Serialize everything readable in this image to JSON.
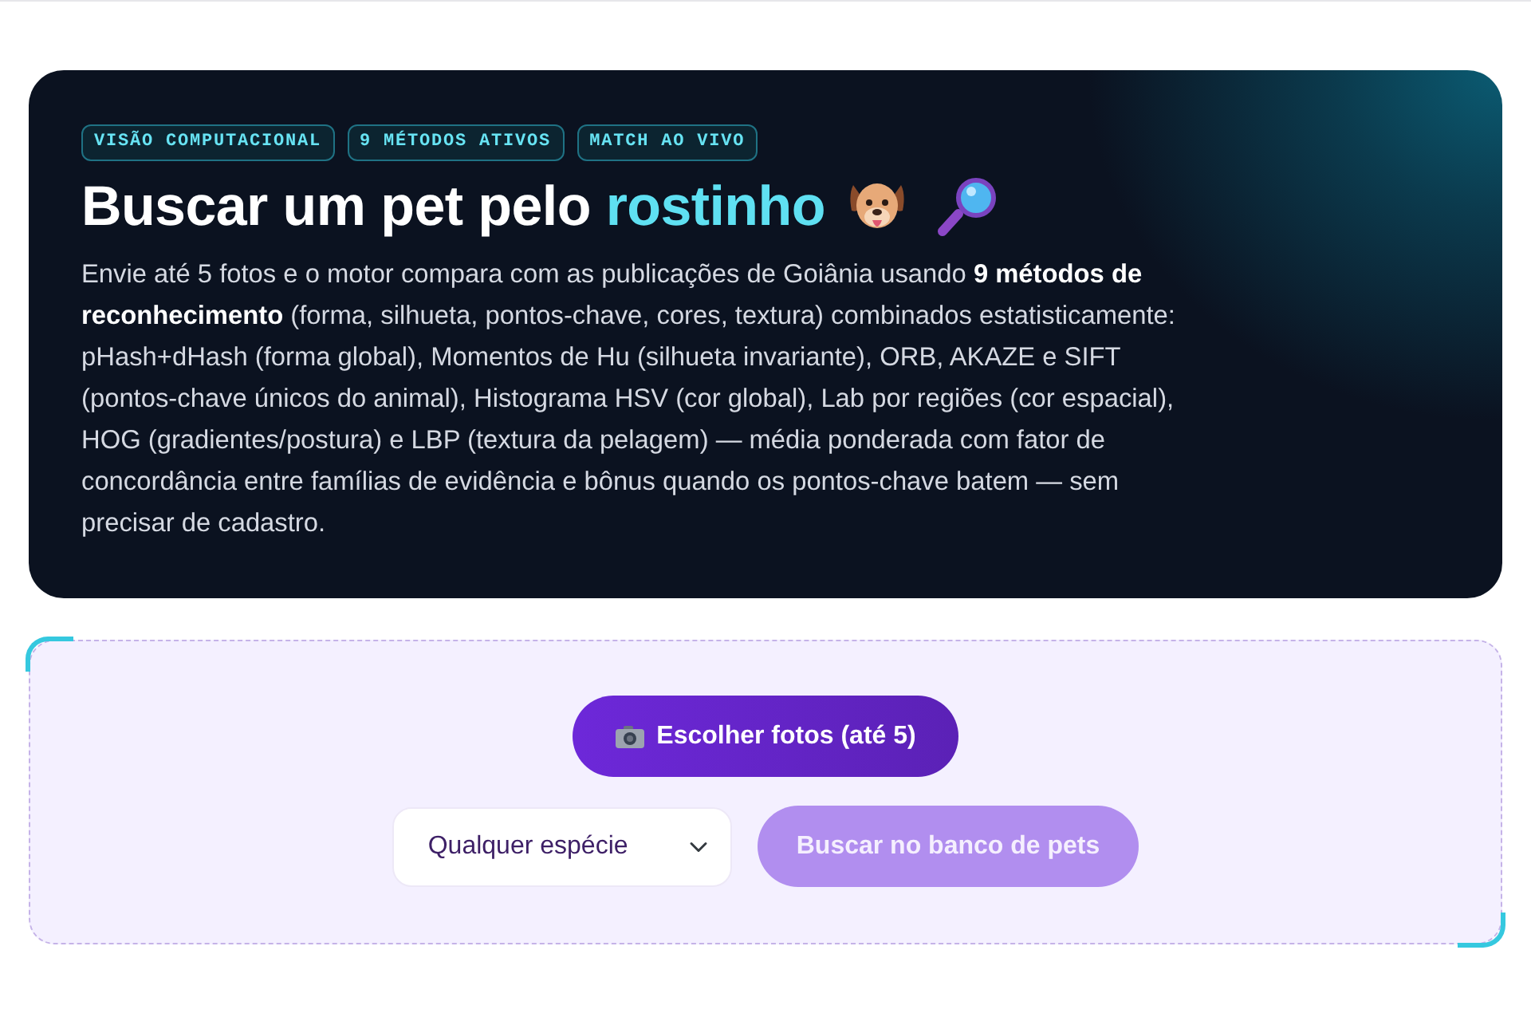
{
  "hero": {
    "badges": [
      "VISÃO COMPUTACIONAL",
      "9 MÉTODOS ATIVOS",
      "MATCH AO VIVO"
    ],
    "title": {
      "text": "Buscar um pet pelo",
      "highlight": "rostinho"
    },
    "description": "Envie até 5 fotos e o motor compara com as publicações de Goiânia usando **9 métodos de reconhecimento** (forma, silhueta, pontos-chave, cores, textura) combinados estatisticamente: pHash+dHash (forma global), Momentos de Hu (silhueta invariante), ORB, AKAZE e SIFT (pontos-chave únicos do animal), Histograma HSV (cor global), Lab por regiões (cor espacial), HOG (gradientes/postura) e LBP (textura da pelagem) — média ponderada com fator de concordância entre famílias de evidência e bônus quando os pontos-chave batem — sem precisar de cadastro."
  },
  "upload": {
    "choose_button": "Escolher fotos (até 5)",
    "species_select": {
      "value": "Qualquer espécie"
    },
    "search_button": {
      "label": "Buscar no banco de pets",
      "disabled": true
    }
  }
}
